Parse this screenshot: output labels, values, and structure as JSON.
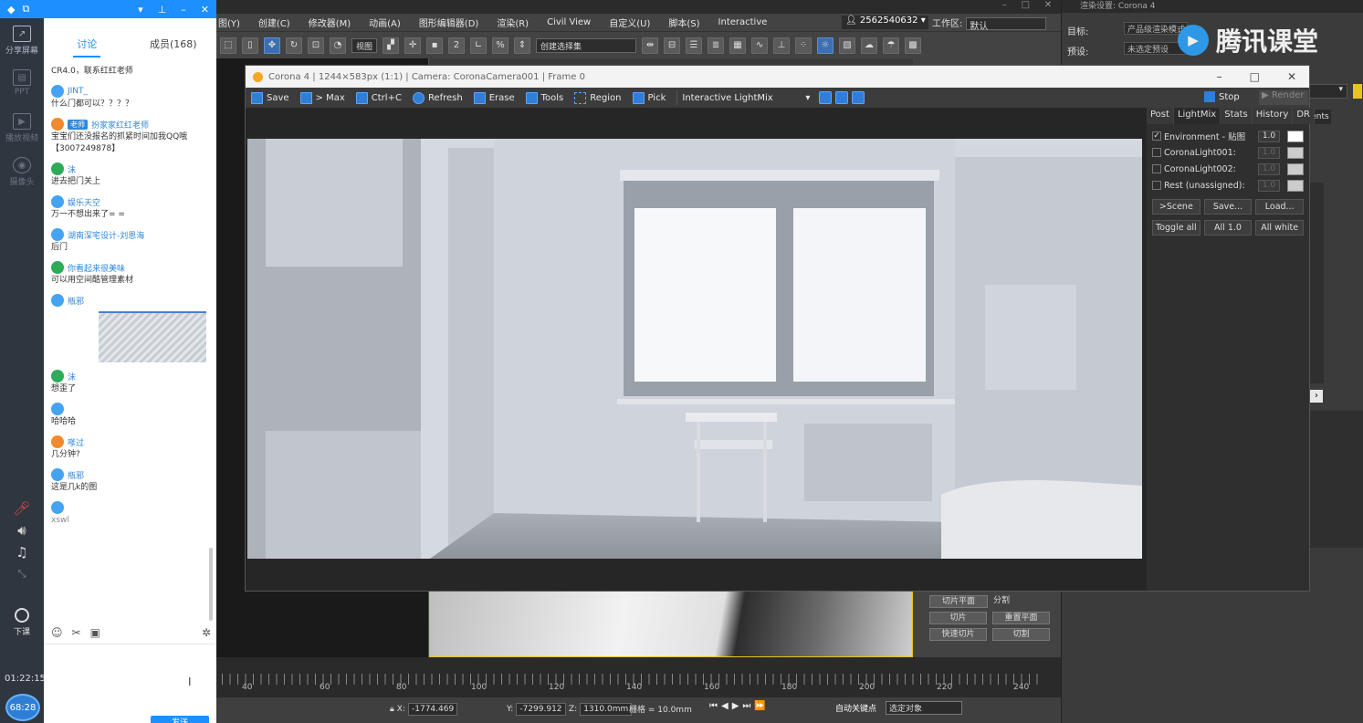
{
  "left_bar": {
    "items": [
      {
        "icon": "share-screen-icon",
        "label": "分享屏幕"
      },
      {
        "icon": "ppt-icon",
        "label": "PPT"
      },
      {
        "icon": "play-video-icon",
        "label": "播放视频"
      },
      {
        "icon": "camera-icon",
        "label": "摄像头"
      }
    ],
    "end_class_label": "下课",
    "time": "01:22:15",
    "badge": "68:28"
  },
  "chat": {
    "tabs": [
      "讨论",
      "成员(168)"
    ],
    "messages": [
      {
        "user": "",
        "text": "CR4.0，联系红红老师"
      },
      {
        "user": "JINT_",
        "text": "什么门都可以？？？？"
      },
      {
        "user": "扮家家红红老师",
        "tag": "老师",
        "text": "宝宝们还没报名的抓紧时间加我QQ哦【3007249878】"
      },
      {
        "user": "沫",
        "text": "进去把门关上"
      },
      {
        "user": "娱乐天空",
        "text": "万一不想出来了= ="
      },
      {
        "user": "湖南深宅设计-刘恩海",
        "text": "后门"
      },
      {
        "user": "你看起来很美味",
        "text": "可以用空间酷管理素材"
      },
      {
        "user": "瓶邪",
        "text": ""
      },
      {
        "user": "沫",
        "text": "想歪了"
      },
      {
        "user": "",
        "text": "哈哈哈"
      },
      {
        "user": "嗲过",
        "text": "几分钟?"
      },
      {
        "user": "瓶邪",
        "text": "这是几k的图"
      },
      {
        "user": "",
        "text": "xswl"
      }
    ],
    "send_label": "发送"
  },
  "max": {
    "menu": [
      "图(Y)",
      "创建(C)",
      "修改器(M)",
      "动画(A)",
      "图形编辑器(D)",
      "渲染(R)",
      "Civil View",
      "自定义(U)",
      "脚本(S)",
      "Interactive"
    ],
    "user": "2562540632",
    "workspace_label": "工作区:",
    "workspace_value": "默认",
    "view_dropdown": "视图",
    "selection_set": "创建选择集",
    "timeline_ticks": [
      "40",
      "60",
      "80",
      "100",
      "120",
      "140",
      "160",
      "180",
      "200",
      "220",
      "240"
    ],
    "coords": {
      "x": "-1774.469",
      "y": "-7299.912",
      "z": "1310.0mm",
      "grid": "栅格 = 10.0mm"
    },
    "autokey": "自动关键点",
    "selected_object": "选定对象",
    "slice_buttons": [
      "切片平面",
      "分割",
      "切片",
      "重置平面",
      "快速切片",
      "切割"
    ]
  },
  "render_setup": {
    "title": "渲染设置: Corona 4",
    "target_label": "目标:",
    "target_value": "产品级渲染模式",
    "preset_label": "预设:",
    "preset_value": "未选定预设",
    "tab_peek": "ents",
    "watermark": "腾讯课堂"
  },
  "vfb": {
    "title": "Corona 4 | 1244×583px (1:1) | Camera: CoronaCamera001 | Frame 0",
    "toolbar": [
      "Save",
      "> Max",
      "Ctrl+C",
      "Refresh",
      "Erase",
      "Tools",
      "Region",
      "Pick"
    ],
    "lightmix_dropdown": "Interactive LightMix",
    "stop_label": "Stop",
    "render_label": "Render",
    "tabs": [
      "Post",
      "LightMix",
      "Stats",
      "History",
      "DR"
    ],
    "lightmix_rows": [
      {
        "name": "Environment - 贴图",
        "value": "1.0",
        "checked": true
      },
      {
        "name": "CoronaLight001:",
        "value": "1.0",
        "checked": false
      },
      {
        "name": "CoronaLight002:",
        "value": "1.0",
        "checked": false
      },
      {
        "name": "Rest (unassigned):",
        "value": "1.0",
        "checked": false
      }
    ],
    "buttons_row1": [
      ">Scene",
      "Save...",
      "Load..."
    ],
    "buttons_row2": [
      "Toggle all",
      "All 1.0",
      "All white"
    ]
  }
}
